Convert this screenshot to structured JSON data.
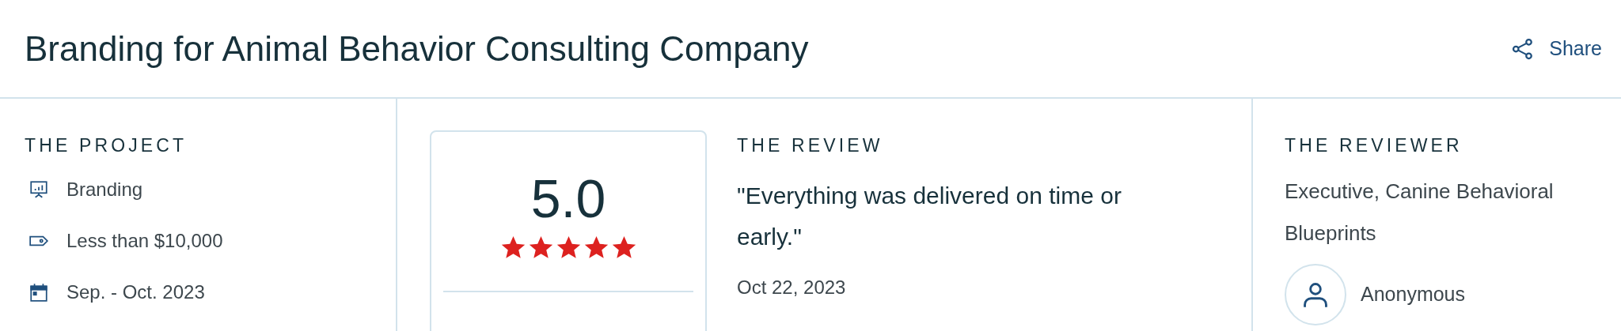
{
  "title": "Branding for Animal Behavior Consulting Company",
  "share": {
    "label": "Share"
  },
  "project": {
    "heading": "THE PROJECT",
    "items": [
      {
        "kind": "service",
        "text": "Branding"
      },
      {
        "kind": "budget",
        "text": "Less than $10,000"
      },
      {
        "kind": "dates",
        "text": "Sep. - Oct. 2023"
      }
    ]
  },
  "rating": {
    "score": "5.0",
    "stars": 5
  },
  "review": {
    "heading": "THE REVIEW",
    "quote": "\"Everything was delivered on time or early.\"",
    "date": "Oct 22, 2023"
  },
  "reviewer": {
    "heading": "THE REVIEWER",
    "role": "Executive, Canine Behavioral Blueprints",
    "name": "Anonymous"
  }
}
